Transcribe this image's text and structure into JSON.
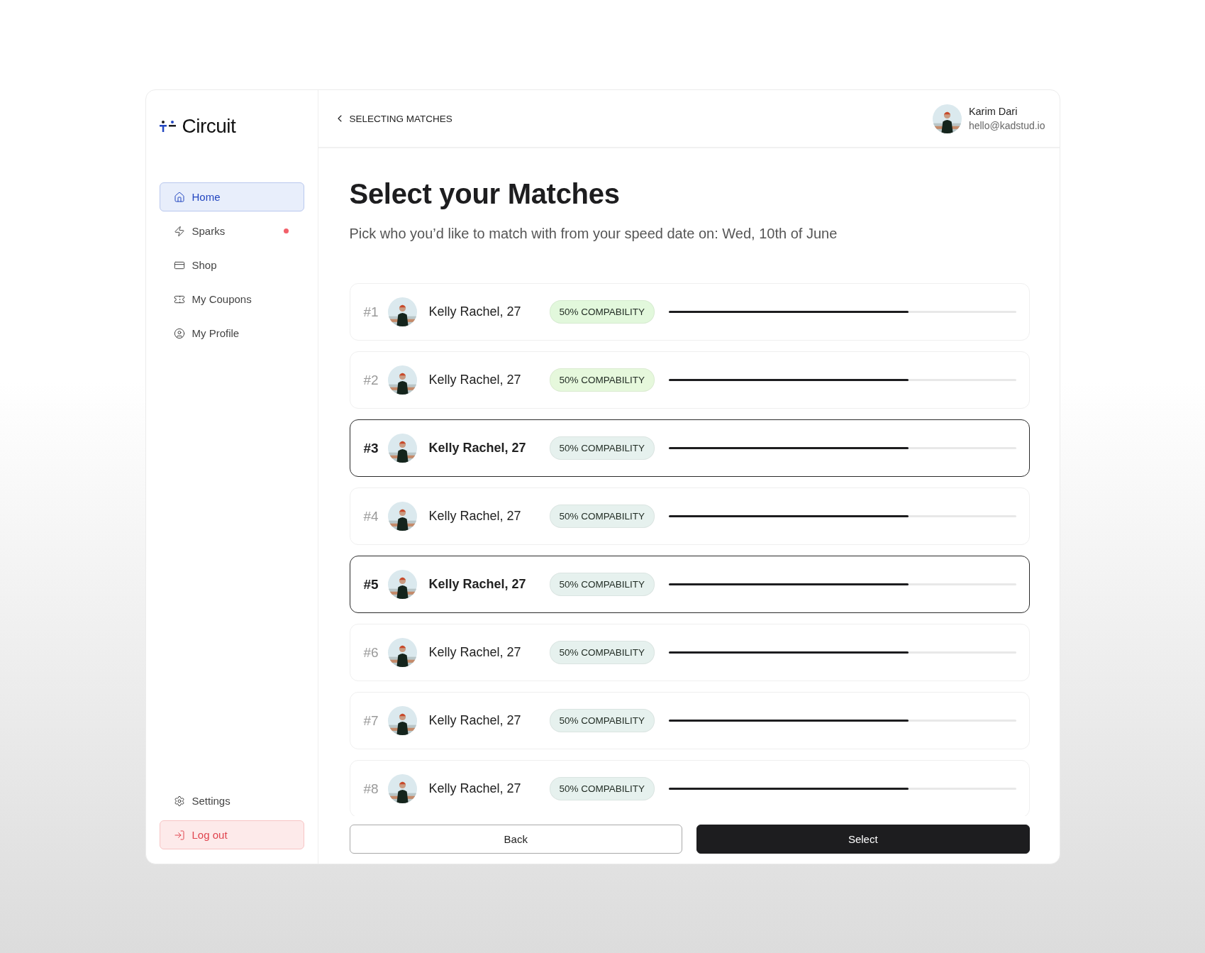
{
  "logo": {
    "text": "Circuit"
  },
  "nav": [
    {
      "label": "Home",
      "kind": "home",
      "selected": true,
      "dot": false
    },
    {
      "label": "Sparks",
      "kind": "spark",
      "selected": false,
      "dot": true
    },
    {
      "label": "Shop",
      "kind": "shop",
      "selected": false,
      "dot": false
    },
    {
      "label": "My Coupons",
      "kind": "coupon",
      "selected": false,
      "dot": false
    },
    {
      "label": "My Profile",
      "kind": "profile",
      "selected": false,
      "dot": false
    }
  ],
  "footer_nav": [
    {
      "label": "Settings",
      "kind": "settings"
    },
    {
      "label": "Log out",
      "kind": "logout"
    }
  ],
  "header": {
    "breadcrumb": "SELECTING MATCHES",
    "user": {
      "name": "Karim Dari",
      "email": "hello@kadstud.io"
    }
  },
  "title": "Select your Matches",
  "subtitle": "Pick who you’d like to match with from your speed date on: Wed, 10th of June",
  "matches": [
    {
      "rank": "#1",
      "name": "Kelly Rachel, 27",
      "badge": "50% COMPABILITY",
      "color": "#e2f8dc",
      "level": 0.69,
      "selected": false
    },
    {
      "rank": "#2",
      "name": "Kelly Rachel, 27",
      "badge": "50% COMPABILITY",
      "color": "#e6f8dc",
      "level": 0.69,
      "selected": false
    },
    {
      "rank": "#3",
      "name": "Kelly Rachel, 27",
      "badge": "50% COMPABILITY",
      "color": "#e6f1ee",
      "level": 0.69,
      "selected": true
    },
    {
      "rank": "#4",
      "name": "Kelly Rachel, 27",
      "badge": "50% COMPABILITY",
      "color": "#e6f1ee",
      "level": 0.69,
      "selected": false
    },
    {
      "rank": "#5",
      "name": "Kelly Rachel, 27",
      "badge": "50% COMPABILITY",
      "color": "#e6f1ee",
      "level": 0.69,
      "selected": true
    },
    {
      "rank": "#6",
      "name": "Kelly Rachel, 27",
      "badge": "50% COMPABILITY",
      "color": "#e6f1ee",
      "level": 0.69,
      "selected": false
    },
    {
      "rank": "#7",
      "name": "Kelly Rachel, 27",
      "badge": "50% COMPABILITY",
      "color": "#e6f1ee",
      "level": 0.69,
      "selected": false
    },
    {
      "rank": "#8",
      "name": "Kelly Rachel, 27",
      "badge": "50% COMPABILITY",
      "color": "#e6f1ee",
      "level": 0.69,
      "selected": false
    }
  ],
  "buttons": [
    {
      "label": "Back",
      "kind": "secondary"
    },
    {
      "label": "Select",
      "kind": "primary"
    }
  ]
}
